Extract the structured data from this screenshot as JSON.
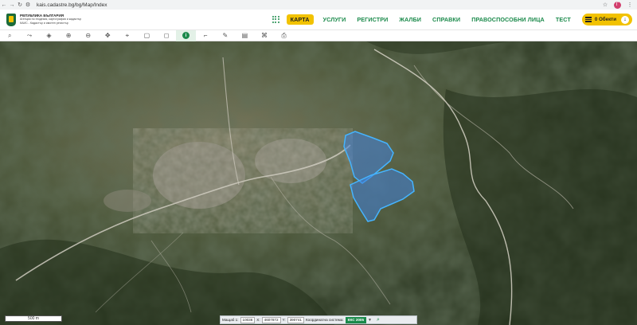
{
  "browser": {
    "url": "kais.cadastre.bg/bg/Map/Index"
  },
  "header": {
    "logo_lines": [
      "РЕПУБЛИКА БЪЛГАРИЯ",
      "Агенция по геодезия, картография и кадастър",
      "КАИС - Кадастър и имотен регистър"
    ],
    "nav": [
      {
        "label": "КАРТА",
        "active": true
      },
      {
        "label": "УСЛУГИ",
        "active": false
      },
      {
        "label": "РЕГИСТРИ",
        "active": false
      },
      {
        "label": "ЖАЛБИ",
        "active": false
      },
      {
        "label": "СПРАВКИ",
        "active": false
      },
      {
        "label": "ПРАВОСПОСОБНИ ЛИЦА",
        "active": false
      },
      {
        "label": "ТЕСТ",
        "active": false
      }
    ],
    "objects_button": "0 Обекти"
  },
  "toolbar": {
    "tools": [
      "search-icon",
      "measure-icon",
      "layers-icon",
      "zoom-in-icon",
      "zoom-out-icon",
      "pan-icon",
      "marker-icon",
      "select-rect-icon",
      "select-polygon-icon",
      "info-icon",
      "corner-icon",
      "pen-icon",
      "map-icon",
      "print-map-icon",
      "printer-icon"
    ]
  },
  "scale_bar": {
    "label": "500 m"
  },
  "status": {
    "scale_label": "Мащаб 1:",
    "scale_value": "10036",
    "x_label": "X:",
    "x_value": "4607872",
    "y_label": "Y:",
    "y_value": "390741",
    "coord_label": "Координатна система:",
    "coord_system": "ККС 2005"
  },
  "colors": {
    "brand_green": "#1b8a4b",
    "accent_yellow": "#f2c200",
    "parcel_fill": "#3f7fd8",
    "parcel_stroke": "#45b4ff"
  }
}
